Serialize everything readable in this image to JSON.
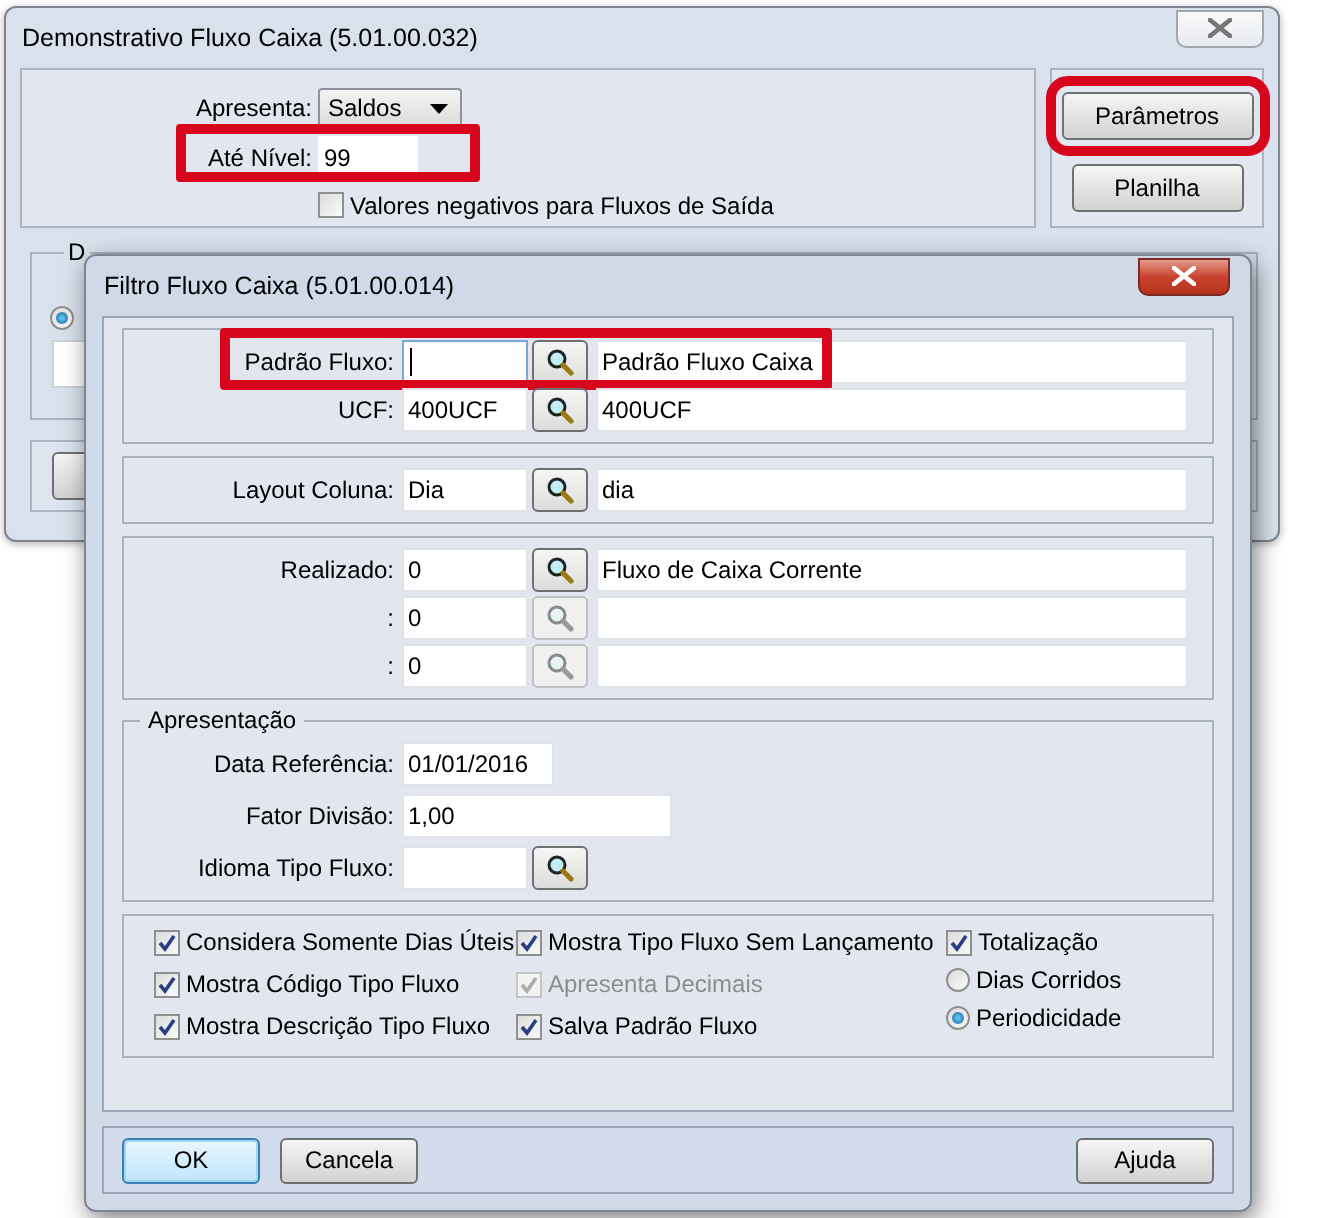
{
  "main_window": {
    "title": "Demonstrativo Fluxo Caixa (5.01.00.032)",
    "apresenta": {
      "label": "Apresenta:",
      "value": "Saldos"
    },
    "ate_nivel": {
      "label": "Até Nível:",
      "value": "99",
      "highlighted": true
    },
    "negative_values": {
      "label": "Valores negativos para Fluxos de Saída",
      "checked": false
    },
    "buttons": [
      {
        "label": "Parâmetros",
        "highlighted": true
      },
      {
        "label": "Planilha",
        "highlighted": false
      }
    ],
    "lower_group": {
      "label": "D",
      "radio_selected": true
    }
  },
  "filter_dialog": {
    "title": "Filtro Fluxo Caixa (5.01.00.014)",
    "sections": [
      {
        "rows": [
          {
            "label": "Padrão Fluxo:",
            "description": "Padrão Fluxo Caixa",
            "lookup_enabled": true,
            "highlighted": true,
            "focused": true
          },
          {
            "label": "UCF:",
            "code": "400UCF",
            "description": "400UCF",
            "lookup_enabled": true,
            "highlighted": false,
            "focused": false
          }
        ]
      },
      {
        "rows": [
          {
            "label": "Layout Coluna:",
            "code": "Dia",
            "description": "dia",
            "lookup_enabled": true,
            "highlighted": false,
            "focused": false
          }
        ]
      },
      {
        "rows": [
          {
            "label": "Realizado:",
            "code": "0",
            "description": "Fluxo de Caixa Corrente",
            "lookup_enabled": true,
            "highlighted": false,
            "focused": false
          },
          {
            "label": ":",
            "code": "0",
            "lookup_enabled": false,
            "highlighted": false,
            "focused": false
          },
          {
            "label": ":",
            "code": "0",
            "lookup_enabled": false,
            "highlighted": false,
            "focused": false
          }
        ]
      }
    ],
    "apresentacao": {
      "title": "Apresentação",
      "fields": [
        {
          "kind": "text",
          "label": "Data Referência:",
          "value": "01/01/2016"
        },
        {
          "kind": "wide",
          "label": "Fator Divisão:",
          "value": "1,00"
        },
        {
          "kind": "lookup",
          "label": "Idioma Tipo Fluxo:"
        }
      ]
    },
    "options": [
      [
        {
          "kind": "checkbox",
          "label": "Considera Somente Dias Úteis",
          "checked": true,
          "disabled": false
        },
        {
          "kind": "checkbox",
          "label": "Mostra Código Tipo Fluxo",
          "checked": true,
          "disabled": false
        },
        {
          "kind": "checkbox",
          "label": "Mostra Descrição Tipo Fluxo",
          "checked": true,
          "disabled": false
        }
      ],
      [
        {
          "kind": "checkbox",
          "label": "Mostra Tipo Fluxo Sem Lançamento",
          "checked": true,
          "disabled": false
        },
        {
          "kind": "checkbox",
          "label": "Apresenta Decimais",
          "checked": true,
          "disabled": true
        },
        {
          "kind": "checkbox",
          "label": "Salva Padrão Fluxo",
          "checked": true,
          "disabled": false
        }
      ],
      [
        {
          "kind": "checkbox",
          "label": "Totalização",
          "checked": true,
          "disabled": false
        },
        {
          "kind": "radio",
          "label": "Dias Corridos",
          "selected": false
        },
        {
          "kind": "radio",
          "label": "Periodicidade",
          "selected": true
        }
      ]
    ],
    "buttons": [
      {
        "label": "OK",
        "default": true
      },
      {
        "label": "Cancela",
        "default": false
      },
      {
        "label": "Ajuda",
        "default": false
      }
    ]
  }
}
